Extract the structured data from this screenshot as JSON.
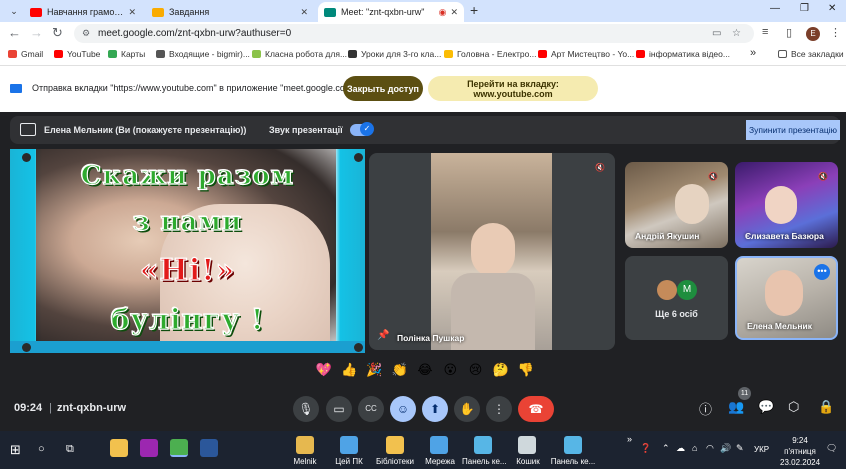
{
  "browser": {
    "tabs": [
      {
        "title": "Навчання грамоти. Велик",
        "favicon_color": "#ff0000",
        "active": false
      },
      {
        "title": "Завдання",
        "favicon_color": "#f9ab00",
        "active": false
      },
      {
        "title": "Meet: \"znt-qxbn-urw\"",
        "favicon_color": "#00897b",
        "active": true
      }
    ],
    "new_tab": "+",
    "window_controls": [
      "—",
      "❐",
      "✕"
    ],
    "url": "meet.google.com/znt-qxbn-urw?authuser=0",
    "profile_initial": "E",
    "bookmarks": [
      {
        "label": "Gmail",
        "color": "#ea4335"
      },
      {
        "label": "YouTube",
        "color": "#ff0000"
      },
      {
        "label": "Карты",
        "color": "#34a853"
      },
      {
        "label": "Входящие - bigmir)...",
        "color": "#555555"
      },
      {
        "label": "Класна робота для...",
        "color": "#8bc34a"
      },
      {
        "label": "Уроки для 3-го кла...",
        "color": "#333333"
      },
      {
        "label": "Головна - Електро...",
        "color": "#fbbc04"
      },
      {
        "label": "Арт Мистецтво - Yo...",
        "color": "#ff0000"
      },
      {
        "label": "інформатика відео...",
        "color": "#ff0000"
      }
    ],
    "bookmarks_more": "»",
    "all_bookmarks": "Все закладки"
  },
  "banner": {
    "message": "Отправка вкладки \"https://www.youtube.com\" в приложение \"meet.google.com\"...",
    "stop_label": "Закрыть доступ",
    "goto_label": "Перейти на вкладку: www.youtube.com"
  },
  "meet": {
    "presenter_text": "Елена Мельник (Ви (покажуєте презентацію))",
    "audio_label": "Звук презентації",
    "stop_presenting": "Зупинити презентацію",
    "slide": {
      "line1": "Скажи разом",
      "line2": "з нами",
      "line3": "«Ні!»",
      "line4": "булінгу !"
    },
    "participants": [
      {
        "name": "Полінка Пушкар"
      },
      {
        "name": "Андрій Якушин"
      },
      {
        "name": "Єлизавета Базюра"
      },
      {
        "name": "Елена Мельник"
      }
    ],
    "others": {
      "label": "Ще 6 осіб",
      "avatar_letter": "M"
    },
    "reactions": [
      "💖",
      "👍",
      "🎉",
      "👏",
      "😂",
      "😮",
      "😢",
      "🤔",
      "👎"
    ],
    "clock": "09:24",
    "meeting_code": "znt-qxbn-urw",
    "people_count": "11"
  },
  "taskbar": {
    "apps": [
      {
        "label": "Melnik",
        "color": "#e6b84f"
      },
      {
        "label": "Цей ПК",
        "color": "#4fa3e6"
      },
      {
        "label": "Бібліотеки",
        "color": "#f2c14e"
      },
      {
        "label": "Мережа",
        "color": "#4fa3e6"
      },
      {
        "label": "Панель ке...",
        "color": "#57b6e6"
      },
      {
        "label": "Кошик",
        "color": "#cfd8dc"
      },
      {
        "label": "Панель ке...",
        "color": "#57b6e6"
      }
    ],
    "lang": "УКР",
    "time": "9:24",
    "day": "п'ятниця",
    "date": "23.02.2024"
  }
}
